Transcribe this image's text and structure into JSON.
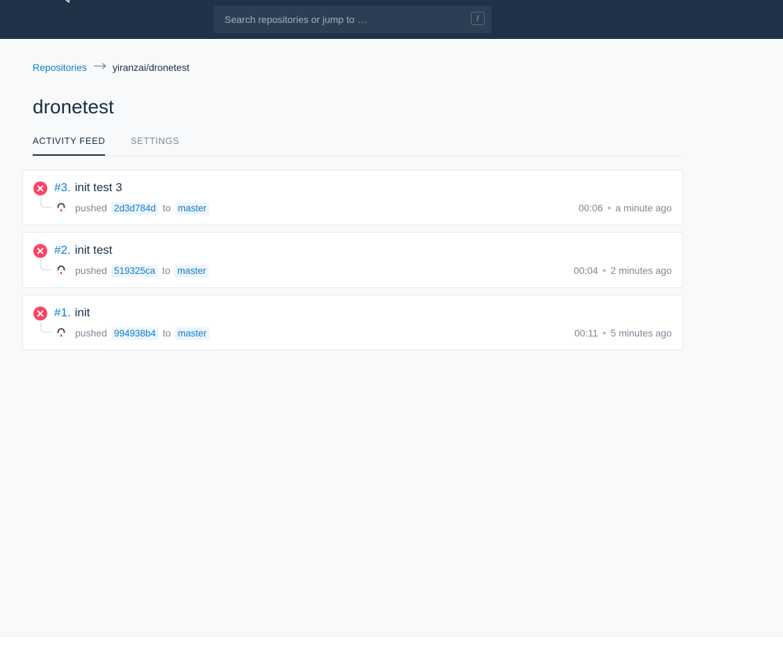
{
  "header": {
    "search_placeholder": "Search repositories or jump to …",
    "search_shortcut": "/"
  },
  "breadcrumb": {
    "root": "Repositories",
    "current": "yiranzai/dronetest"
  },
  "repo": {
    "title": "dronetest"
  },
  "tabs": [
    {
      "label": "ACTIVITY FEED",
      "active": true
    },
    {
      "label": "SETTINGS",
      "active": false
    }
  ],
  "builds": [
    {
      "number": "#3.",
      "message": "init test 3",
      "action": "pushed",
      "commit": "2d3d784d",
      "to": "to",
      "branch": "master",
      "duration": "00:06",
      "ago": "a minute ago",
      "status": "failure"
    },
    {
      "number": "#2.",
      "message": "init test",
      "action": "pushed",
      "commit": "519325ca",
      "to": "to",
      "branch": "master",
      "duration": "00:04",
      "ago": "2 minutes ago",
      "status": "failure"
    },
    {
      "number": "#1.",
      "message": "init",
      "action": "pushed",
      "commit": "994938b4",
      "to": "to",
      "branch": "master",
      "duration": "00:11",
      "ago": "5 minutes ago",
      "status": "failure"
    }
  ],
  "colors": {
    "header_bg": "#1f3247",
    "link": "#0b7ed0",
    "failure": "#ff4164",
    "text": "#192d46",
    "muted": "#7b8794"
  }
}
